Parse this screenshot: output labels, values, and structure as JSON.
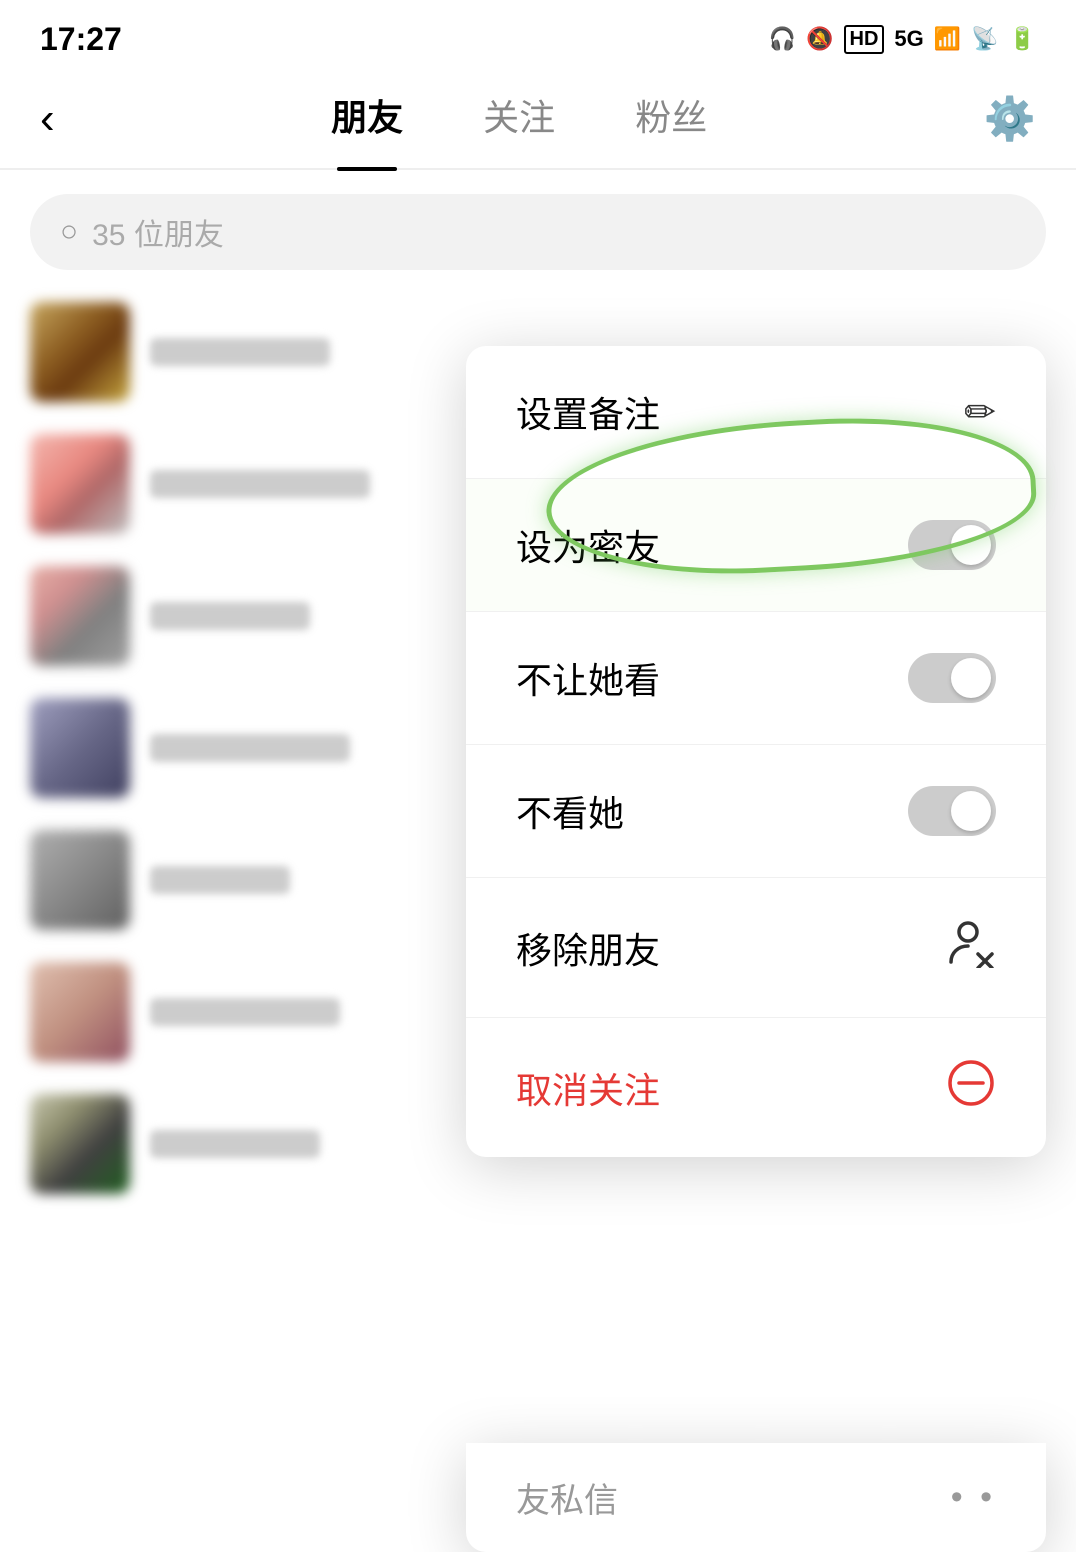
{
  "statusBar": {
    "time": "17:27",
    "icons": [
      "headset",
      "bell-off",
      "hd",
      "5g",
      "signal",
      "wifi",
      "battery"
    ]
  },
  "navBar": {
    "backLabel": "‹",
    "tabs": [
      {
        "label": "朋友",
        "active": true
      },
      {
        "label": "关注",
        "active": false
      },
      {
        "label": "粉丝",
        "active": false
      }
    ],
    "settingsLabel": "⚙"
  },
  "searchBar": {
    "placeholder": "35 位朋友"
  },
  "contextMenu": {
    "items": [
      {
        "id": "set-remark",
        "label": "设置备注",
        "iconType": "edit",
        "iconText": "✏️",
        "actionType": "icon"
      },
      {
        "id": "set-close-friend",
        "label": "设为密友",
        "iconType": "toggle",
        "circled": true,
        "actionType": "toggle"
      },
      {
        "id": "block-her-view",
        "label": "不让她看",
        "iconType": "toggle",
        "actionType": "toggle"
      },
      {
        "id": "block-her",
        "label": "不看她",
        "iconType": "toggle",
        "actionType": "toggle"
      },
      {
        "id": "remove-friend",
        "label": "移除朋友",
        "iconType": "remove-user",
        "actionType": "icon"
      },
      {
        "id": "unfollow",
        "label": "取消关注",
        "iconType": "minus-circle",
        "actionType": "icon",
        "red": true
      }
    ]
  },
  "partialItem": {
    "label": "友私信",
    "dots": "• •"
  },
  "colors": {
    "accent": "#7ec860",
    "red": "#e53935",
    "toggleOff": "#cccccc",
    "menuBg": "#ffffff"
  }
}
